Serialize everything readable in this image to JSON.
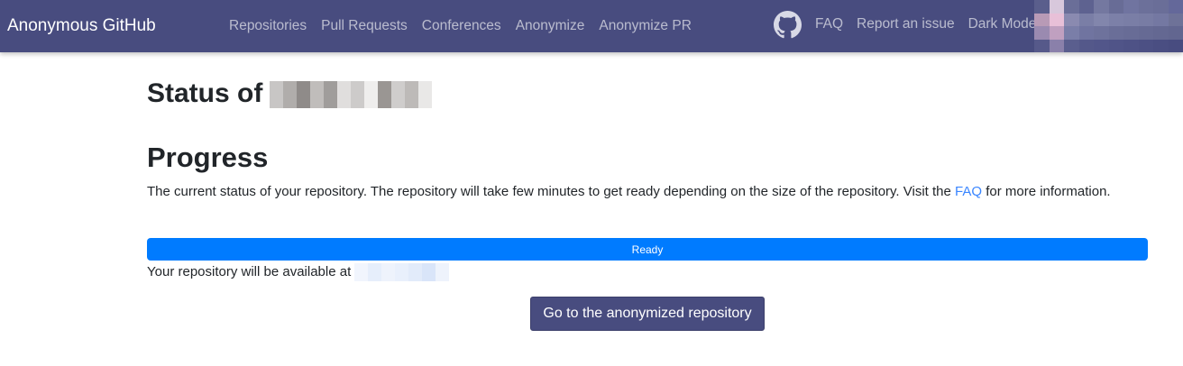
{
  "navbar": {
    "brand": "Anonymous GitHub",
    "left_links": [
      "Repositories",
      "Pull Requests",
      "Conferences",
      "Anonymize",
      "Anonymize PR"
    ],
    "github_icon": "github-icon",
    "right_links": [
      "FAQ",
      "Report an issue",
      "Dark Mode"
    ],
    "background_color": "#484c7f"
  },
  "page": {
    "status_label": "Status of",
    "progress_heading": "Progress",
    "description_before": "The current status of your repository. The repository will take few minutes to get ready depending on the size of the repository. Visit the ",
    "description_link": "FAQ",
    "description_after": " for more information.",
    "progress_label": "Ready",
    "progress_value": 100,
    "progress_color": "#007bff",
    "available_text": "Your repository will be available at",
    "button_label": "Go to the anonymized repository",
    "link_color": "#3a86ff"
  }
}
